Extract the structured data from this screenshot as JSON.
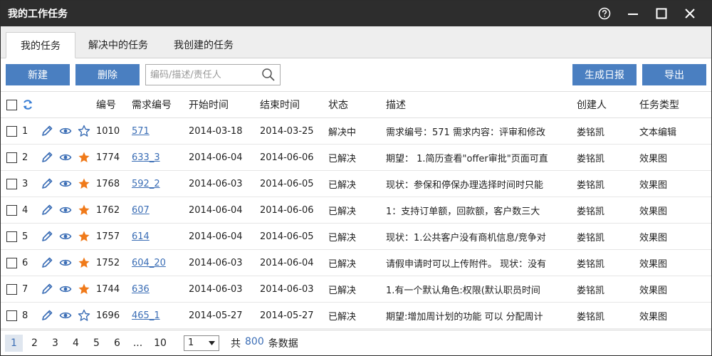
{
  "window": {
    "title": "我的工作任务"
  },
  "tabs": [
    {
      "label": "我的任务"
    },
    {
      "label": "解决中的任务"
    },
    {
      "label": "我创建的任务"
    }
  ],
  "toolbar": {
    "new_label": "新建",
    "delete_label": "删除",
    "search_placeholder": "编码/描述/责任人",
    "report_label": "生成日报",
    "export_label": "导出"
  },
  "table": {
    "columns": [
      "编号",
      "需求编号",
      "开始时间",
      "结束时间",
      "状态",
      "描述",
      "创建人",
      "任务类型"
    ],
    "rows": [
      {
        "idx": "1",
        "starred": false,
        "id": "1010",
        "req": "571",
        "start": "2014-03-18",
        "end": "2014-03-25",
        "status": "解决中",
        "desc": "需求编号：571 需求内容：评审和修改",
        "creator": "娄铭凯",
        "type": "文本编辑"
      },
      {
        "idx": "2",
        "starred": true,
        "id": "1774",
        "req": "633_3",
        "start": "2014-06-04",
        "end": "2014-06-06",
        "status": "已解决",
        "desc": "期望： 1.简历查看\"offer审批\"页面可直",
        "creator": "娄铭凯",
        "type": "效果图"
      },
      {
        "idx": "3",
        "starred": true,
        "id": "1768",
        "req": "592_2",
        "start": "2014-06-03",
        "end": "2014-06-05",
        "status": "已解决",
        "desc": "现状：参保和停保办理选择时间时只能",
        "creator": "娄铭凯",
        "type": "效果图"
      },
      {
        "idx": "4",
        "starred": true,
        "id": "1762",
        "req": "607",
        "start": "2014-06-04",
        "end": "2014-06-06",
        "status": "已解决",
        "desc": "1：支持订单额，回款额，客户数三大",
        "creator": "娄铭凯",
        "type": "效果图"
      },
      {
        "idx": "5",
        "starred": true,
        "id": "1757",
        "req": "614",
        "start": "2014-06-04",
        "end": "2014-06-05",
        "status": "已解决",
        "desc": "现状：1.公共客户没有商机信息/竞争对",
        "creator": "娄铭凯",
        "type": "效果图"
      },
      {
        "idx": "6",
        "starred": true,
        "id": "1752",
        "req": "604_20",
        "start": "2014-06-03",
        "end": "2014-06-04",
        "status": "已解决",
        "desc": "请假申请时可以上传附件。 现状：没有",
        "creator": "娄铭凯",
        "type": "效果图"
      },
      {
        "idx": "7",
        "starred": true,
        "id": "1744",
        "req": "636",
        "start": "2014-06-03",
        "end": "2014-06-03",
        "status": "已解决",
        "desc": "1.有一个默认角色:权限(默认职员时间",
        "creator": "娄铭凯",
        "type": "效果图"
      },
      {
        "idx": "8",
        "starred": false,
        "id": "1696",
        "req": "465_1",
        "start": "2014-05-27",
        "end": "2014-05-27",
        "status": "已解决",
        "desc": "期望:增加周计划的功能 可以 分配周计",
        "creator": "娄铭凯",
        "type": "效果图"
      }
    ]
  },
  "pager": {
    "pages": [
      "1",
      "2",
      "3",
      "4",
      "5",
      "6",
      "...",
      "10"
    ],
    "current": "1",
    "select_value": "1",
    "total_prefix": "共",
    "total_count": "800",
    "total_suffix": "条数据"
  },
  "colors": {
    "accent": "#4a7fc1",
    "star": "#f07a1a",
    "link": "#3a6db5",
    "titlebar": "#2d2d2d"
  },
  "icons": {
    "row_actions": [
      "pencil-icon",
      "eye-icon",
      "star-icon"
    ],
    "header": "refresh-icon"
  }
}
